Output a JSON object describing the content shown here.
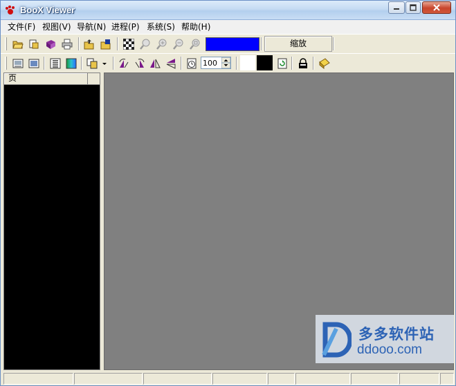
{
  "window": {
    "title": "BooX Viewer",
    "app_icon": "paw-icon",
    "controls": [
      "minimize-icon",
      "restore-icon",
      "close-icon"
    ]
  },
  "menubar": {
    "items": [
      {
        "label": "文件(F)"
      },
      {
        "label": "视图(V)"
      },
      {
        "label": "导航(N)"
      },
      {
        "label": "进程(P)"
      },
      {
        "label": "系统(S)"
      },
      {
        "label": "帮助(H)"
      }
    ]
  },
  "toolbar1": {
    "buttons": [
      "open-folder-icon",
      "open-file-icon",
      "book-icon",
      "print-icon",
      "folder-up-icon",
      "folder-export-icon",
      "checker-icon",
      "zoom-icon",
      "zoom-in-icon",
      "zoom-out-icon",
      "zoom-fit-icon"
    ],
    "color_value": "#0000ff",
    "zoom_label": "缩放"
  },
  "toolbar2": {
    "buttons": [
      "single-page-icon",
      "fullscreen-icon",
      "thumbnails-icon",
      "gradient-icon",
      "copy-pages-icon",
      "dropdown-arrow-icon",
      "rotate-left-icon",
      "rotate-right-icon",
      "flip-vertical-icon",
      "flip-horizontal-icon",
      "timer-icon",
      "refresh-icon",
      "lock-icon",
      "notes-icon"
    ],
    "interval_value": "100",
    "swatch_fg": "#ffffff",
    "swatch_bg": "#000000"
  },
  "left_panel": {
    "column_header": "页"
  },
  "watermark": {
    "text_cn": "多多软件站",
    "url": "ddooo.com"
  },
  "colors": {
    "canvas": "#808080",
    "panel": "#000000",
    "chrome": "#ece9d8",
    "accent": "#0000ff"
  }
}
